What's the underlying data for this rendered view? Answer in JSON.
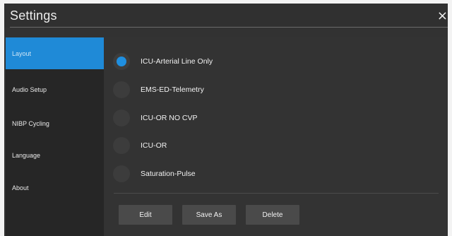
{
  "window": {
    "title": "Settings",
    "close_glyph": "×"
  },
  "sidebar": {
    "items": [
      {
        "label": "Layout",
        "active": true
      },
      {
        "label": "Audio Setup",
        "active": false
      },
      {
        "label": "NIBP Cycling",
        "active": false
      },
      {
        "label": "Language",
        "active": false
      },
      {
        "label": "About",
        "active": false
      }
    ]
  },
  "layouts": {
    "selected": "ICU-Arterial Line Only",
    "options": [
      {
        "label": "ICU-Arterial Line Only",
        "checked": true
      },
      {
        "label": "EMS-ED-Telemetry",
        "checked": false
      },
      {
        "label": "ICU-OR NO CVP",
        "checked": false
      },
      {
        "label": "ICU-OR",
        "checked": false
      },
      {
        "label": "Saturation-Pulse",
        "checked": false
      }
    ]
  },
  "actions": {
    "edit_label": "Edit",
    "save_as_label": "Save As",
    "delete_label": "Delete"
  },
  "colors": {
    "accent": "#1f8ad7",
    "radio_selected": "#1f8fe0",
    "background": "#333333",
    "sidebar": "#262626"
  }
}
